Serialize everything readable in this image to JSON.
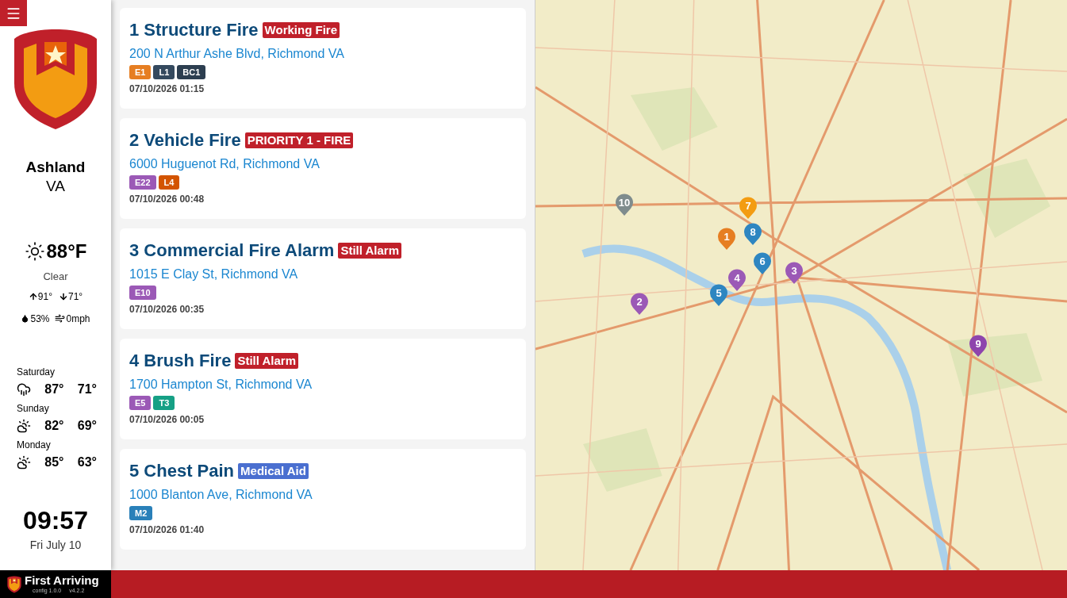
{
  "location": {
    "city": "Ashland",
    "state": "VA"
  },
  "weather": {
    "temperature": "88°F",
    "condition": "Clear",
    "high": "91°",
    "low": "71°",
    "humidity": "53%",
    "wind": "0mph"
  },
  "forecast": [
    {
      "day": "Saturday",
      "kind": "rain",
      "high": "87°",
      "low": "71°"
    },
    {
      "day": "Sunday",
      "kind": "partly-cloudy",
      "high": "82°",
      "low": "69°"
    },
    {
      "day": "Monday",
      "kind": "partly-cloudy",
      "high": "85°",
      "low": "63°"
    }
  ],
  "clock": {
    "time": "09:57",
    "date": "Fri July 10"
  },
  "incidents": [
    {
      "title": "1 Structure Fire",
      "alert": {
        "label": "Working Fire",
        "color": "#c0202a"
      },
      "address": "200 N Arthur Ashe Blvd, Richmond VA",
      "units": [
        {
          "label": "E1",
          "color": "#e67e22"
        },
        {
          "label": "L1",
          "color": "#34495e"
        },
        {
          "label": "BC1",
          "color": "#2c3e50"
        }
      ],
      "timestamp": "07/10/2026 01:15"
    },
    {
      "title": "2 Vehicle Fire",
      "alert": {
        "label": "PRIORITY 1 - FIRE",
        "color": "#c0202a"
      },
      "address": "6000 Huguenot Rd, Richmond VA",
      "units": [
        {
          "label": "E22",
          "color": "#9b59b6"
        },
        {
          "label": "L4",
          "color": "#d35400"
        }
      ],
      "timestamp": "07/10/2026 00:48"
    },
    {
      "title": "3 Commercial Fire Alarm",
      "alert": {
        "label": "Still Alarm",
        "color": "#c0202a"
      },
      "address": "1015 E Clay St, Richmond VA",
      "units": [
        {
          "label": "E10",
          "color": "#9b59b6"
        }
      ],
      "timestamp": "07/10/2026 00:35"
    },
    {
      "title": "4 Brush Fire",
      "alert": {
        "label": "Still Alarm",
        "color": "#c0202a"
      },
      "address": "1700 Hampton St, Richmond VA",
      "units": [
        {
          "label": "E5",
          "color": "#9b59b6"
        },
        {
          "label": "T3",
          "color": "#16a085"
        }
      ],
      "timestamp": "07/10/2026 00:05"
    },
    {
      "title": "5 Chest Pain",
      "alert": {
        "label": "Medical Aid",
        "color": "#4a6fd0"
      },
      "address": "1000 Blanton Ave, Richmond VA",
      "units": [
        {
          "label": "M2",
          "color": "#2980b9"
        }
      ],
      "timestamp": "07/10/2026 01:40"
    }
  ],
  "map": {
    "pins": [
      {
        "label": "1",
        "color": "#e67e22"
      },
      {
        "label": "2",
        "color": "#9b59b6"
      },
      {
        "label": "3",
        "color": "#9b59b6"
      },
      {
        "label": "4",
        "color": "#9b59b6"
      },
      {
        "label": "5",
        "color": "#2e86c1"
      },
      {
        "label": "6",
        "color": "#2e86c1"
      },
      {
        "label": "7",
        "color": "#f39c12"
      },
      {
        "label": "8",
        "color": "#2e86c1"
      },
      {
        "label": "9",
        "color": "#8e44ad"
      },
      {
        "label": "10",
        "color": "#7f8c8d"
      }
    ]
  },
  "footer": {
    "brand": "First Arriving",
    "config": "config 1.0.0",
    "version": "v4.2.2"
  }
}
